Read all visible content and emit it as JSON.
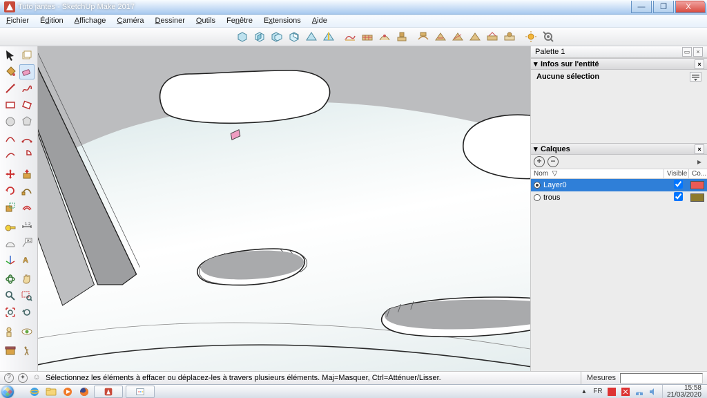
{
  "window": {
    "title": "Tuto jantes - SketchUp Make 2017",
    "min_label": "—",
    "max_label": "❐",
    "close_label": "X"
  },
  "menu": {
    "file": "Fichier",
    "edit": "Édition",
    "view": "Affichage",
    "camera": "Caméra",
    "draw": "Dessiner",
    "tools": "Outils",
    "windowm": "Fenêtre",
    "extensions": "Extensions",
    "help": "Aide"
  },
  "tray": {
    "palette_title": "Palette 1",
    "entity_title": "Infos sur l'entité",
    "entity_body": "Aucune sélection",
    "layers_title": "Calques",
    "layers_name_col": "Nom",
    "layers_visible_col": "Visible",
    "layers_color_col": "Co...",
    "layers": [
      {
        "name": "Layer0",
        "visible": true,
        "color": "#ea5a55",
        "active": true,
        "selected": true
      },
      {
        "name": "trous",
        "visible": true,
        "color": "#8d7a2d",
        "active": false,
        "selected": false
      }
    ]
  },
  "status": {
    "hint": "Sélectionnez les éléments à effacer ou déplacez-les à travers plusieurs éléments. Maj=Masquer, Ctrl=Atténuer/Lisser.",
    "measures_label": "Mesures",
    "measures_value": ""
  },
  "taskbar": {
    "lang": "FR",
    "time": "15:58",
    "date": "21/03/2020"
  }
}
